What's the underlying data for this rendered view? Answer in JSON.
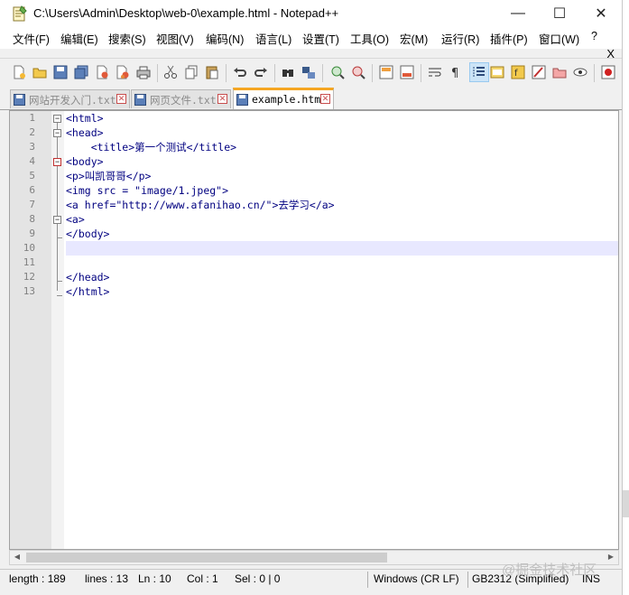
{
  "window": {
    "title": "C:\\Users\\Admin\\Desktop\\web-0\\example.html - Notepad++",
    "minimize": "—",
    "maximize": "☐",
    "close": "✕"
  },
  "menu": {
    "items": [
      "文件(F)",
      "编辑(E)",
      "搜索(S)",
      "视图(V)",
      "编码(N)",
      "语言(L)",
      "设置(T)",
      "工具(O)",
      "宏(M)",
      "运行(R)",
      "插件(P)",
      "窗口(W)",
      "?"
    ],
    "close_doc": "X"
  },
  "toolbar": {
    "icons": [
      "new-file-icon",
      "open-file-icon",
      "save-icon",
      "save-all-icon",
      "close-icon",
      "close-all-icon",
      "print-icon",
      "cut-icon",
      "copy-icon",
      "paste-icon",
      "undo-icon",
      "redo-icon",
      "find-icon",
      "replace-icon",
      "zoom-in-icon",
      "zoom-out-icon",
      "sync-vertical-icon",
      "sync-horizontal-icon",
      "word-wrap-icon",
      "show-all-chars-icon",
      "indent-guide-icon",
      "doc-map-icon",
      "function-list-icon",
      "folder-workspace-icon",
      "monitoring-icon",
      "eye-icon",
      "record-macro-icon"
    ]
  },
  "tabs": [
    {
      "label": "网站开发入门.txt",
      "active": false
    },
    {
      "label": "网页文件.txt",
      "active": false
    },
    {
      "label": "example.html",
      "active": true
    }
  ],
  "editor": {
    "lines": [
      {
        "num": "1",
        "text": "<html>"
      },
      {
        "num": "2",
        "text": "<head>"
      },
      {
        "num": "3",
        "text": "    <title>第一个测试</title>"
      },
      {
        "num": "4",
        "text": "<body>"
      },
      {
        "num": "5",
        "text": "<p>叫凯哥哥</p>"
      },
      {
        "num": "6",
        "text": "<img src = \"image/1.jpeg\">"
      },
      {
        "num": "7",
        "text": "<a href=\"http://www.afanihao.cn/\">去学习</a>"
      },
      {
        "num": "8",
        "text": "<a>"
      },
      {
        "num": "9",
        "text": "</body>"
      },
      {
        "num": "10",
        "text": ""
      },
      {
        "num": "11",
        "text": ""
      },
      {
        "num": "12",
        "text": "</head>"
      },
      {
        "num": "13",
        "text": "</html>"
      }
    ],
    "current_line": 10
  },
  "status": {
    "length": "length : 189",
    "lines": "lines : 13",
    "ln": "Ln : 10",
    "col": "Col : 1",
    "sel": "Sel : 0 | 0",
    "eol": "Windows (CR LF)",
    "encoding": "GB2312 (Simplified)",
    "mode": "INS"
  },
  "watermark": "@掘金技术社区"
}
